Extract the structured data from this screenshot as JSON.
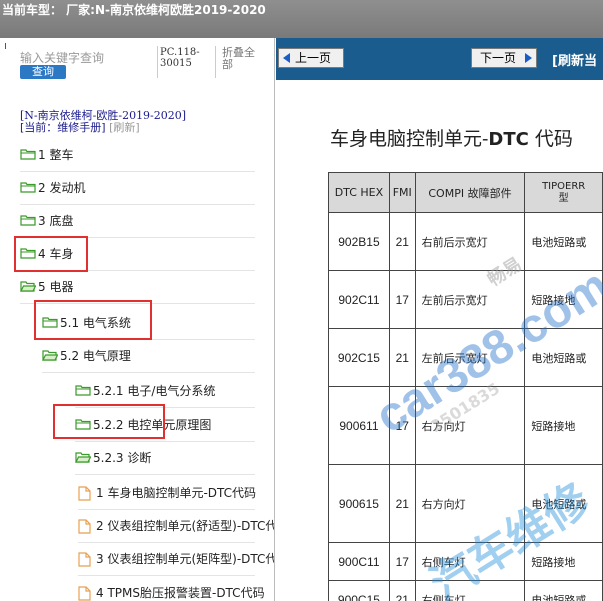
{
  "header": {
    "current_model_label": "当前车型：  厂家:N-南京依维柯欧胜2019-2020"
  },
  "left_panel": {
    "search_placeholder": "输入关键字查询",
    "search_button": "查询",
    "pc_code": "PC.118-\n30015",
    "collapse_all": "折叠全\n部",
    "path": "[N-南京依维柯-欧胜-2019-2020]",
    "current_prefix": "[当前：维修手册]",
    "refresh": "[刷新]",
    "tree": [
      {
        "label": "1 整车",
        "type": "folder",
        "highlighted": false
      },
      {
        "label": "2 发动机",
        "type": "folder",
        "highlighted": false
      },
      {
        "label": "3 底盘",
        "type": "folder",
        "highlighted": false
      },
      {
        "label": "4 车身",
        "type": "folder",
        "highlighted": false
      },
      {
        "label": "5 电器",
        "type": "folder-open",
        "highlighted": true
      },
      {
        "label": "5.1 电气系统",
        "type": "folder",
        "highlighted": false
      },
      {
        "label": "5.2 电气原理",
        "type": "folder-open",
        "highlighted": true
      },
      {
        "label": "5.2.1 电子/电气分系统",
        "type": "folder",
        "highlighted": false
      },
      {
        "label": "5.2.2 电控单元原理图",
        "type": "folder",
        "highlighted": false
      },
      {
        "label": "5.2.3 诊断",
        "type": "folder-open",
        "highlighted": true
      },
      {
        "label": "1 车身电脑控制单元-DTC代码",
        "type": "document",
        "highlighted": false
      },
      {
        "label": "2 仪表组控制单元(舒适型)-DTC代码",
        "type": "document",
        "highlighted": false
      },
      {
        "label": "3 仪表组控制单元(矩阵型)-DTC代码",
        "type": "document",
        "highlighted": false
      },
      {
        "label": "4 TPMS胎压报警装置-DTC代码",
        "type": "document",
        "highlighted": false
      }
    ]
  },
  "right_panel": {
    "prev_button": "上一页",
    "next_button": "下一页",
    "refresh_link": "[刷新当",
    "doc_title_pre": "车身电脑控制单元-",
    "doc_title_bold": "DTC",
    "doc_title_post": " 代码",
    "table": {
      "headers": [
        "DTC HEX",
        "FMI",
        "COMPI 故障部件",
        "TIPOERR",
        "型"
      ],
      "rows": [
        [
          "902B15",
          "21",
          "右前后示宽灯",
          "电池短路或"
        ],
        [
          "902C11",
          "17",
          "左前后示宽灯",
          "短路接地"
        ],
        [
          "902C15",
          "21",
          "左前后示宽灯",
          "电池短路或"
        ],
        [
          "900611",
          "17",
          "右方向灯",
          "短路接地"
        ],
        [
          "900615",
          "21",
          "右方向灯",
          "电池短路或"
        ],
        [
          "900C11",
          "17",
          "右侧车灯",
          "短路接地"
        ],
        [
          "900C15",
          "21",
          "右侧车灯",
          "电池短路或"
        ]
      ]
    },
    "watermarks": [
      "car388.com",
      "畅易",
      "汽车维修",
      "2501835"
    ]
  },
  "colors": {
    "top_bar": "#858585",
    "nav_bar": "#1a5c8e",
    "highlight_box": "#e03030",
    "folder": "#3a9a2a",
    "document": "#e8a050",
    "query_button": "#2b78c5"
  }
}
